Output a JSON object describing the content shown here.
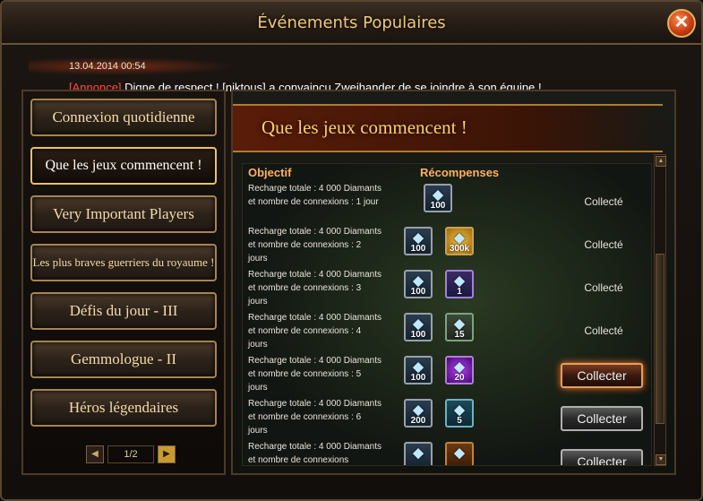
{
  "window": {
    "title": "Événements Populaires",
    "close_label": "✕"
  },
  "announcement": {
    "date": "13.04.2014 00:54",
    "tag": "[Annonce]",
    "message": " Digne de respect ! [niktous] a convaincu Zweihander de se joindre à son équipe !"
  },
  "sidebar": {
    "items": [
      {
        "label": "Connexion quotidienne"
      },
      {
        "label": "Que les jeux commencent !",
        "active": true
      },
      {
        "label": "Very Important Players"
      },
      {
        "label": "Les plus braves guerriers du royaume !"
      },
      {
        "label": "Défis du jour - III"
      },
      {
        "label": "Gemmologue - II"
      },
      {
        "label": "Héros légendaires"
      }
    ],
    "pager": {
      "prev": "◀",
      "current": "1/2",
      "next": "▶"
    }
  },
  "panel": {
    "banner": "Que les jeux commencent !",
    "col_objective": "Objectif",
    "col_rewards": "Récompenses",
    "rows": [
      {
        "desc": "Recharge totale : 4 000 Diamants et nombre de connexions : 1 jour",
        "rewards": [
          {
            "icon": "diamond-icon",
            "qty": "100",
            "style": ""
          }
        ],
        "status": "Collecté"
      },
      {
        "desc": "Recharge totale : 4 000 Diamants et nombre de connexions : 2 jours",
        "rewards": [
          {
            "icon": "diamond-icon",
            "qty": "100",
            "style": ""
          },
          {
            "icon": "gold-coin-icon",
            "qty": "300k",
            "style": "gold"
          }
        ],
        "status": "Collecté"
      },
      {
        "desc": "Recharge totale : 4 000 Diamants et nombre de connexions : 3 jours",
        "rewards": [
          {
            "icon": "diamond-icon",
            "qty": "100",
            "style": ""
          },
          {
            "icon": "gem-box-icon",
            "qty": "1",
            "style": "gem"
          }
        ],
        "status": "Collecté"
      },
      {
        "desc": "Recharge totale : 4 000 Diamants et nombre de connexions : 4 jours",
        "rewards": [
          {
            "icon": "diamond-icon",
            "qty": "100",
            "style": ""
          },
          {
            "icon": "stamina-icon",
            "qty": "15",
            "style": "green"
          }
        ],
        "status": "Collecté"
      },
      {
        "desc": "Recharge totale : 4 000 Diamants et nombre de connexions : 5 jours",
        "rewards": [
          {
            "icon": "diamond-icon",
            "qty": "100",
            "style": ""
          },
          {
            "icon": "magic-orb-icon",
            "qty": "20",
            "style": "purple"
          }
        ],
        "button": "Collecter",
        "glow": true
      },
      {
        "desc": "Recharge totale : 4 000 Diamants et nombre de connexions : 6 jours",
        "rewards": [
          {
            "icon": "diamond-icon",
            "qty": "200",
            "style": ""
          },
          {
            "icon": "potion-icon",
            "qty": "5",
            "style": "teal"
          }
        ],
        "button": "Collecter"
      },
      {
        "desc": "Recharge totale : 4 000 Diamants et nombre de connexions",
        "rewards": [
          {
            "icon": "diamond-icon",
            "qty": "",
            "style": ""
          },
          {
            "icon": "chest-icon",
            "qty": "",
            "style": "orange"
          }
        ],
        "button": "Collecter"
      }
    ]
  },
  "scrollbar": {
    "up": "▲",
    "down": "▼"
  }
}
